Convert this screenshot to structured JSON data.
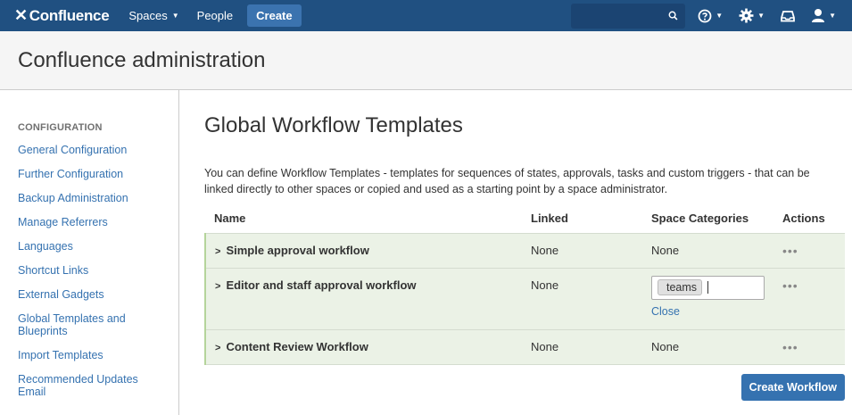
{
  "topnav": {
    "logo_mark": "✕",
    "logo_text": "Confluence",
    "spaces_label": "Spaces",
    "people_label": "People",
    "create_label": "Create"
  },
  "page": {
    "title": "Confluence administration"
  },
  "sidebar": {
    "heading": "CONFIGURATION",
    "items": [
      "General Configuration",
      "Further Configuration",
      "Backup Administration",
      "Manage Referrers",
      "Languages",
      "Shortcut Links",
      "External Gadgets",
      "Global Templates and Blueprints",
      "Import Templates",
      "Recommended Updates Email"
    ]
  },
  "main": {
    "heading": "Global Workflow Templates",
    "description": "You can define Workflow Templates - templates for sequences of states, approvals, tasks and custom triggers - that can be linked directly to other spaces or copied and used as a starting point by a space administrator.",
    "table": {
      "headers": [
        "Name",
        "Linked",
        "Space Categories",
        "Actions"
      ],
      "rows": [
        {
          "name": "Simple approval workflow",
          "linked": "None",
          "categories": "None",
          "actions": "•••"
        },
        {
          "name": "Editor and staff approval workflow",
          "linked": "None",
          "tag": "teams",
          "close": "Close",
          "actions": "•••"
        },
        {
          "name": "Content Review Workflow",
          "linked": "None",
          "categories": "None",
          "actions": "•••"
        }
      ]
    },
    "create_button": "Create Workflow"
  },
  "icons": [
    "search-icon",
    "help-icon",
    "gear-icon",
    "notifications-icon",
    "user-avatar-icon"
  ],
  "colors": {
    "topbar": "#205081",
    "link": "#3572b0",
    "row_bg": "#ebf2e6",
    "button": "#3572b0"
  }
}
